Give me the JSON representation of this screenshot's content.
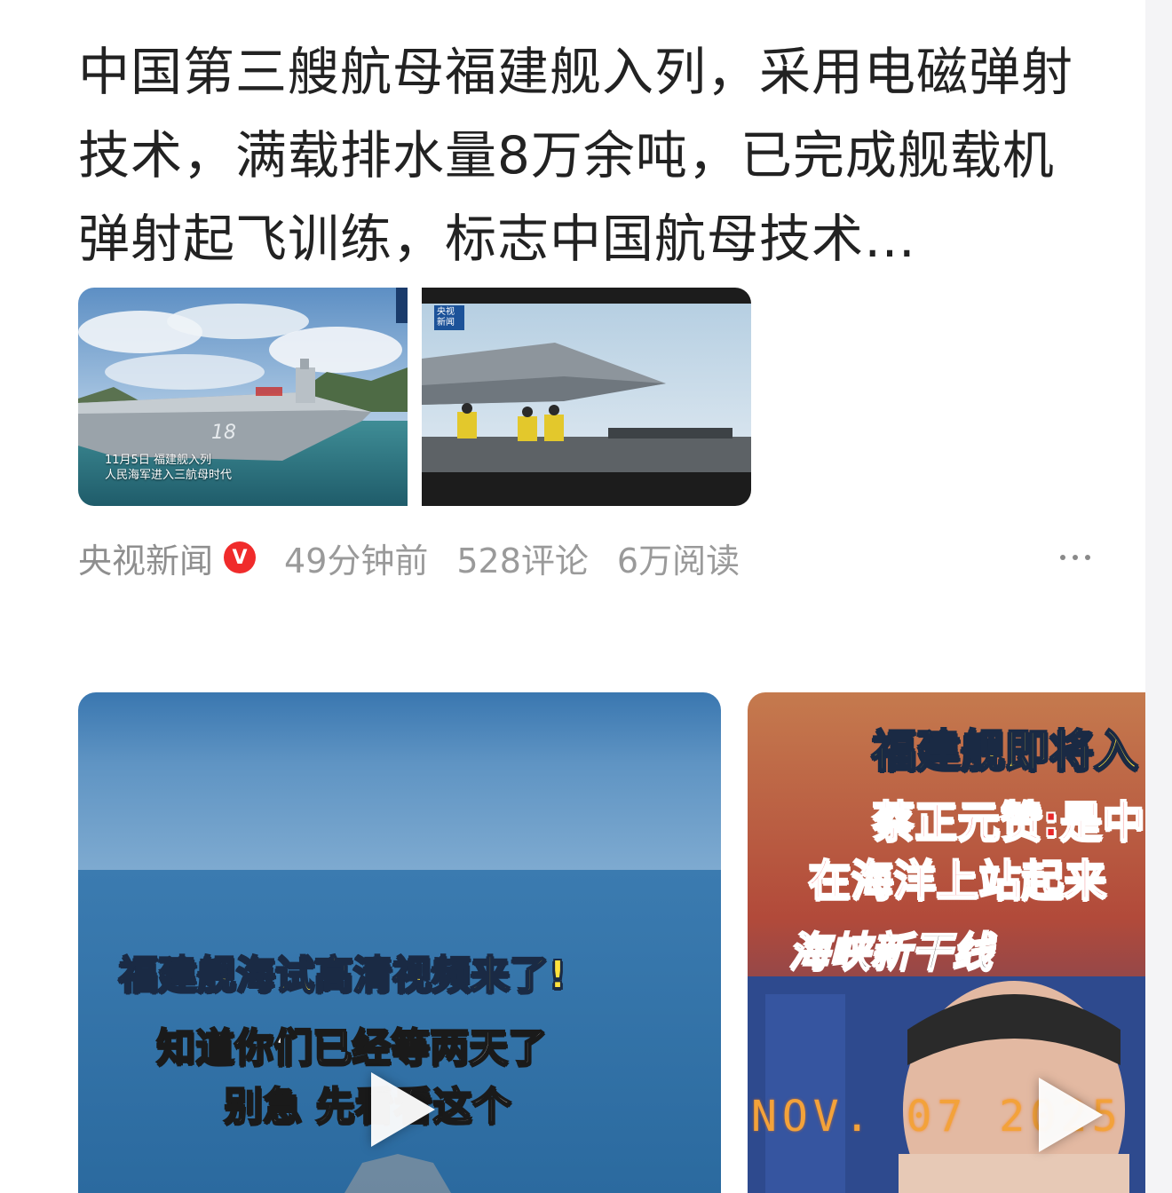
{
  "article": {
    "title": "中国第三艘航母福建舰入列，采用电磁弹射技术，满载排水量8万余吨，已完成舰载机弹射起飞训练，标志中国航母技术…",
    "images": [
      {
        "caption_line1": "11月5日 福建舰入列",
        "caption_line2": "人民海军进入三航母时代"
      },
      {
        "tag": "央视新闻"
      }
    ],
    "meta": {
      "source": "央视新闻",
      "verified_badge": "V",
      "time": "49分钟前",
      "comments": "528评论",
      "reads": "6万阅读"
    }
  },
  "videos": [
    {
      "overlay_title": "福建舰海试高清视频来了!",
      "overlay_line2": "知道你们已经等两天了",
      "overlay_line3": "别急 先看看这个"
    },
    {
      "overlay_title": "福建舰即将入",
      "overlay_line2": "蔡正元赞:是中",
      "overlay_line3": "在海洋上站起来",
      "program_logo": "海峡新干线",
      "date_stamp": "NOV. 07 2025"
    }
  ],
  "colors": {
    "title_text": "#222222",
    "meta_text": "#9a9a9a",
    "verified_red": "#f02b2b"
  }
}
